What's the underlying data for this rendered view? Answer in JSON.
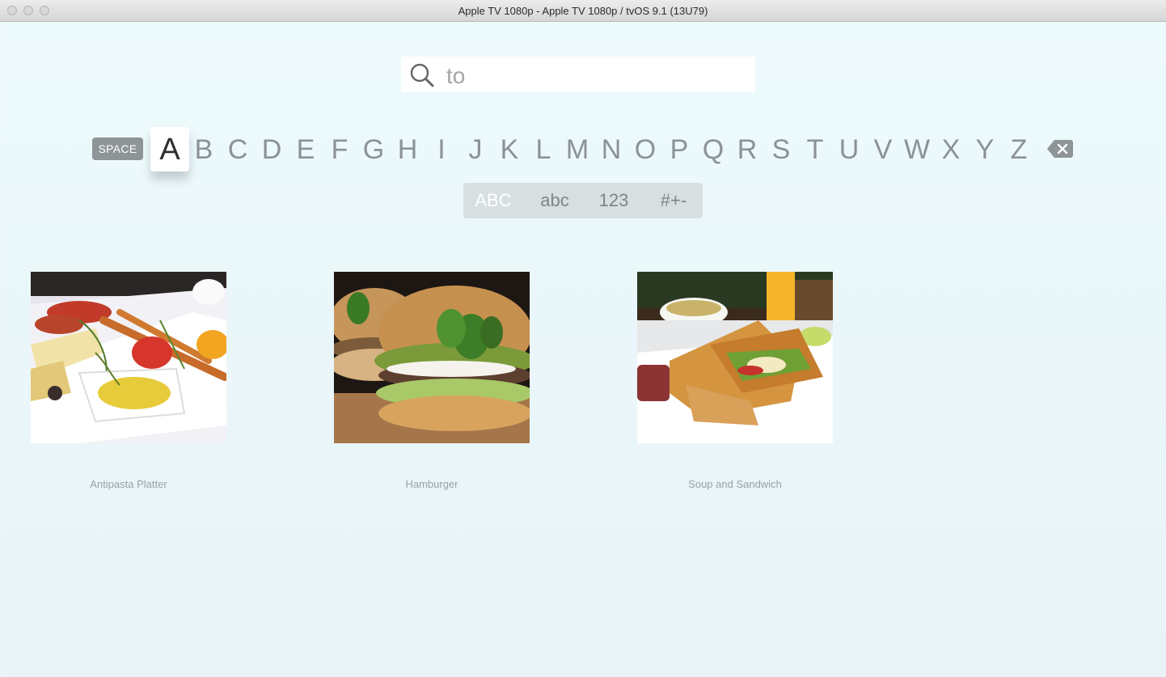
{
  "window": {
    "title": "Apple TV 1080p - Apple TV 1080p / tvOS 9.1 (13U79)"
  },
  "search": {
    "query": "to",
    "icon": "search-icon"
  },
  "keyboard": {
    "space_label": "SPACE",
    "letters": [
      "A",
      "B",
      "C",
      "D",
      "E",
      "F",
      "G",
      "H",
      "I",
      "J",
      "K",
      "L",
      "M",
      "N",
      "O",
      "P",
      "Q",
      "R",
      "S",
      "T",
      "U",
      "V",
      "W",
      "X",
      "Y",
      "Z"
    ],
    "focused_letter": "A",
    "delete_icon": "delete-backward-icon",
    "modes": [
      "ABC",
      "abc",
      "123",
      "#+-"
    ],
    "selected_mode": "ABC"
  },
  "results": [
    {
      "title": "Antipasta Platter",
      "image": "antipasta-platter-photo"
    },
    {
      "title": "Hamburger",
      "image": "hamburger-photo"
    },
    {
      "title": "Soup and Sandwich",
      "image": "soup-and-sandwich-photo"
    }
  ]
}
